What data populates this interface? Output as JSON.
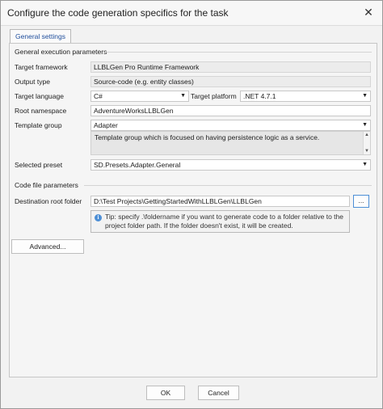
{
  "window": {
    "title": "Configure the code generation specifics for the task",
    "close_glyph": "✕"
  },
  "tabs": [
    {
      "label": "General settings"
    }
  ],
  "general": {
    "section_label": "General execution parameters",
    "target_framework": {
      "label": "Target framework",
      "value": "LLBLGen Pro Runtime Framework"
    },
    "output_type": {
      "label": "Output type",
      "value": "Source-code (e.g. entity classes)"
    },
    "target_language": {
      "label": "Target language",
      "value": "C#"
    },
    "target_platform": {
      "label": "Target platform",
      "value": ".NET 4.7.1"
    },
    "root_namespace": {
      "label": "Root namespace",
      "value": "AdventureWorksLLBLGen"
    },
    "template_group": {
      "label": "Template group",
      "value": "Adapter",
      "description": "Template group which is focused on having persistence logic as a service."
    },
    "selected_preset": {
      "label": "Selected preset",
      "value": "SD.Presets.Adapter.General"
    }
  },
  "codefile": {
    "section_label": "Code file parameters",
    "destination": {
      "label": "Destination root folder",
      "value": "D:\\Test Projects\\GettingStartedWithLLBLGen\\LLBLGen",
      "browse_label": "..."
    },
    "tip": "Tip: specify .\\foldername if you want to generate code to a folder relative to the project folder path. If the folder doesn't exist, it will be created."
  },
  "buttons": {
    "advanced": "Advanced...",
    "ok": "OK",
    "cancel": "Cancel"
  },
  "icons": {
    "dropdown": "chevron-down-icon",
    "info": "info-icon"
  }
}
